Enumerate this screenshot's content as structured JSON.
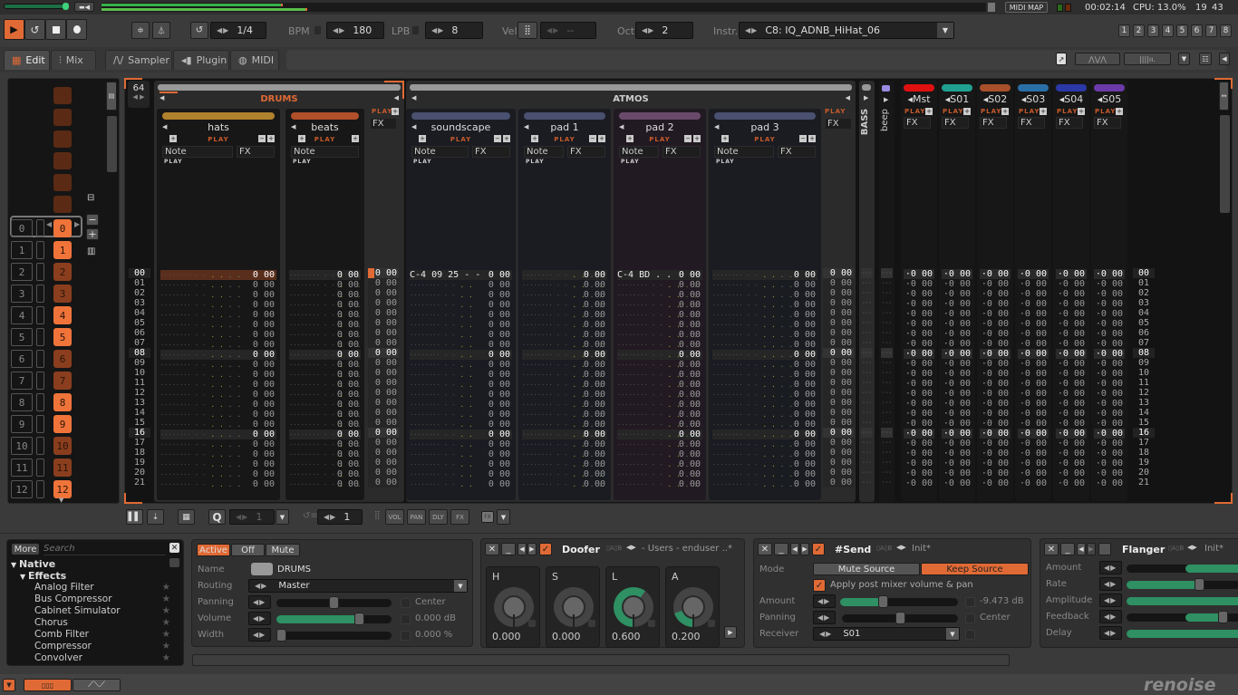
{
  "topbar": {
    "midi_map": "MIDI MAP",
    "time": "00:02:14",
    "cpu": "CPU: 13.0%",
    "clock_h": "19",
    "clock_m": "43"
  },
  "transport": {
    "loop_block": "1/4",
    "bpm_label": "BPM",
    "bpm": "180",
    "lpb_label": "LPB",
    "lpb": "8",
    "vel_label": "Vel",
    "vel": "--",
    "oct_label": "Oct",
    "oct": "2",
    "instr_label": "Instr.",
    "instrument": "C8: IQ_ADNB_HiHat_06",
    "track_sets": [
      "1",
      "2",
      "3",
      "4",
      "5",
      "6",
      "7",
      "8"
    ]
  },
  "tabs": {
    "edit": "Edit",
    "mix": "Mix",
    "sampler": "Sampler",
    "plugin": "Plugin",
    "midi": "MIDI"
  },
  "sequencer": {
    "lines_count": "64",
    "positions": [
      "0",
      "1",
      "2",
      "3",
      "4",
      "5",
      "6",
      "7",
      "8",
      "9",
      "10",
      "11",
      "12"
    ],
    "patterns": [
      {
        "n": "0",
        "active": true
      },
      {
        "n": "1",
        "active": true
      },
      {
        "n": "2",
        "active": false
      },
      {
        "n": "3",
        "active": false
      },
      {
        "n": "4",
        "active": true
      },
      {
        "n": "5",
        "active": true
      },
      {
        "n": "6",
        "active": false
      },
      {
        "n": "7",
        "active": false
      },
      {
        "n": "8",
        "active": true
      },
      {
        "n": "9",
        "active": true
      },
      {
        "n": "10",
        "active": false
      },
      {
        "n": "11",
        "active": false
      },
      {
        "n": "12",
        "active": true
      }
    ]
  },
  "groups": {
    "drums": "DRUMS",
    "atmos": "ATMOS",
    "bass": "BASS",
    "beep": "beep"
  },
  "tracks": [
    {
      "name": "hats",
      "color": "#b0822e",
      "first_row": "········ - -   . .  . .   - -"
    },
    {
      "name": "beats",
      "color": "#b0502a",
      "first_row": "········ - -   . .  . ."
    },
    {
      "name": "soundscape",
      "color": "#4a5070",
      "first_row": "C-4 09 25  - -"
    },
    {
      "name": "pad 1",
      "color": "#4a5070",
      "first_row": "········ - -   . ."
    },
    {
      "name": "pad 2",
      "color": "#6a4a6a",
      "first_row": "C-4 BD  . ."
    },
    {
      "name": "pad 3",
      "color": "#4a5070",
      "first_row": "········ - -   . .  . ."
    }
  ],
  "track_labels": {
    "play": "PLAY",
    "note": "Note",
    "fx": "FX",
    "fx_value": "0 00"
  },
  "sends": [
    {
      "name": "Mst",
      "color": "#e01010"
    },
    {
      "name": "S01",
      "color": "#20a090"
    },
    {
      "name": "S02",
      "color": "#a8502a"
    },
    {
      "name": "S03",
      "color": "#2a70a8"
    },
    {
      "name": "S04",
      "color": "#2a38a8"
    },
    {
      "name": "S05",
      "color": "#6a3aa8"
    }
  ],
  "row_numbers": [
    "00",
    "01",
    "02",
    "03",
    "04",
    "05",
    "06",
    "07",
    "08",
    "09",
    "10",
    "11",
    "12",
    "13",
    "14",
    "15",
    "16",
    "17",
    "18",
    "19",
    "20",
    "21"
  ],
  "pattern_toolbar": {
    "quantize": "1",
    "edit_step": "1",
    "vol": "VOL",
    "pan": "PAN",
    "dly": "DLY",
    "fx": "FX",
    "fx2": "FX"
  },
  "browser": {
    "more": "More",
    "search_placeholder": "Search",
    "native": "Native",
    "effects": "Effects",
    "items": [
      "Analog Filter",
      "Bus Compressor",
      "Cabinet Simulator",
      "Chorus",
      "Comb Filter",
      "Compressor",
      "Convolver"
    ]
  },
  "track_dsp": {
    "active": "Active",
    "off": "Off",
    "mute": "Mute",
    "name_label": "Name",
    "name": "DRUMS",
    "routing_label": "Routing",
    "routing": "Master",
    "panning_label": "Panning",
    "panning_value": "Center",
    "panning_pos": 0.5,
    "volume_label": "Volume",
    "volume_value": "0.000 dB",
    "volume_level": 0.74,
    "width_label": "Width",
    "width_value": "0.000 %",
    "width_level": 0.0
  },
  "doofer": {
    "title": "Doofer",
    "preset": "- Users - enduser ..*",
    "knobs": [
      {
        "label": "H",
        "value": "0.000",
        "level": 0.0
      },
      {
        "label": "S",
        "value": "0.000",
        "level": 0.0
      },
      {
        "label": "L",
        "value": "0.600",
        "level": 0.6
      },
      {
        "label": "A",
        "value": "0.200",
        "level": 0.2
      }
    ]
  },
  "send": {
    "title": "#Send",
    "preset": "Init*",
    "mode_label": "Mode",
    "mute_source": "Mute Source",
    "keep_source": "Keep Source",
    "apply_post": "Apply post mixer volume & pan",
    "amount_label": "Amount",
    "amount_value": "-9.473 dB",
    "amount_level": 0.35,
    "panning_label": "Panning",
    "panning_value": "Center",
    "panning_pos": 0.5,
    "receiver_label": "Receiver",
    "receiver": "S01"
  },
  "flanger": {
    "title": "Flanger",
    "preset": "Init*",
    "params": [
      {
        "label": "Amount",
        "fill_from": 0.5,
        "level": 1.0
      },
      {
        "label": "Rate",
        "fill_from": 0.0,
        "level": 0.62
      },
      {
        "label": "Amplitude",
        "fill_from": 0.0,
        "level": 1.0
      },
      {
        "label": "Feedback",
        "fill_from": 0.5,
        "level": 0.82
      },
      {
        "label": "Delay",
        "fill_from": 0.0,
        "level": 1.0
      }
    ]
  },
  "brand": "renoise"
}
